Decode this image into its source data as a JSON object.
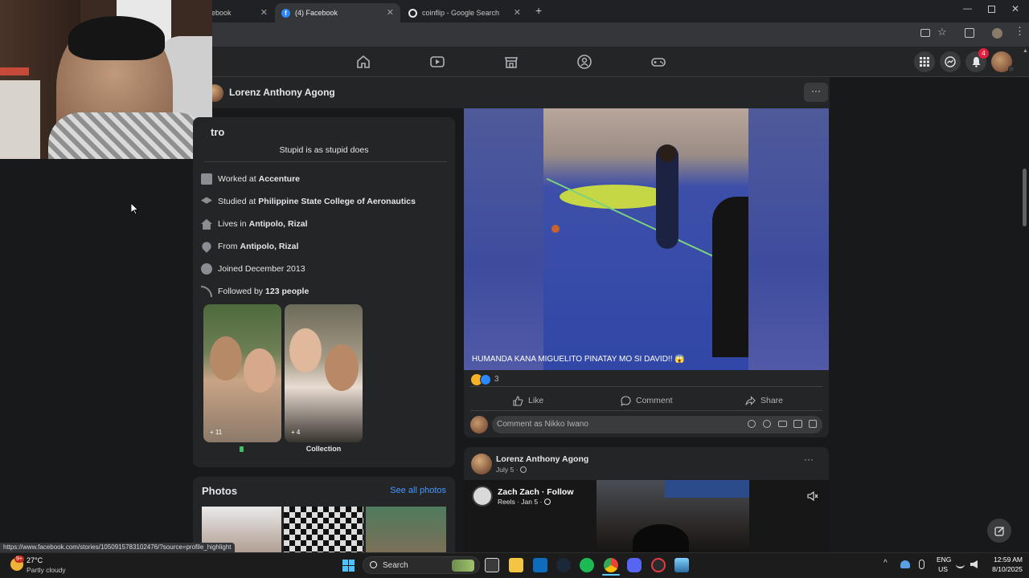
{
  "browser": {
    "tabs": [
      {
        "label": "ebook",
        "active": false
      },
      {
        "label": "(4) Facebook",
        "active": true
      },
      {
        "label": "coinflip - Google Search",
        "active": false
      }
    ],
    "status_url": "https://www.facebook.com/stories/1050915783102476/?source=profile_highlight"
  },
  "facebook": {
    "notification_count": "4",
    "profile_name": "Lorenz Anthony Agong",
    "intro": {
      "title": "tro",
      "bio": "Stupid is as stupid does",
      "rows": [
        {
          "prefix": "Worked at",
          "value": "Accenture",
          "icon": "briefcase-icon"
        },
        {
          "prefix": "Studied at",
          "value": "Philippine State College of Aeronautics",
          "icon": "graduation-cap-icon"
        },
        {
          "prefix": "Lives in",
          "value": "Antipolo, Rizal",
          "icon": "home-icon"
        },
        {
          "prefix": "From",
          "value": "Antipolo, Rizal",
          "icon": "location-pin-icon"
        },
        {
          "prefix": "Joined December 2013",
          "value": "",
          "icon": "clock-icon"
        },
        {
          "prefix": "Followed by",
          "value": "123 people",
          "icon": "rss-icon"
        }
      ],
      "highlights": [
        {
          "count": "+ 11",
          "label": ""
        },
        {
          "count": "+ 4",
          "label": "Collection"
        }
      ]
    },
    "photos": {
      "title": "Photos",
      "see_all": "See all photos"
    },
    "post1": {
      "caption": "HUMANDA KANA MIGUELITO PINATAY MO SI DAVID!! 😱",
      "reaction_count": "3",
      "actions": {
        "like": "Like",
        "comment": "Comment",
        "share": "Share"
      },
      "comment_placeholder": "Comment as Nikko Iwano"
    },
    "post2": {
      "author": "Lorenz Anthony Agong",
      "date": "July 5 ·",
      "shared_author": "Zach Zach · Follow",
      "shared_meta": "Reels · Jan 5 ·"
    }
  },
  "taskbar": {
    "weather_temp": "27°C",
    "weather_desc": "Partly cloudy",
    "weather_badge": "9+",
    "search_label": "Search",
    "lang_top": "ENG",
    "lang_bottom": "US",
    "time": "12:59 AM",
    "date": "8/10/2025"
  },
  "colors": {
    "fb_blue": "#2d88ff",
    "notification_red": "#e41e3f",
    "card_bg": "#242526",
    "page_bg": "#18191a",
    "link_blue": "#4599ff"
  }
}
